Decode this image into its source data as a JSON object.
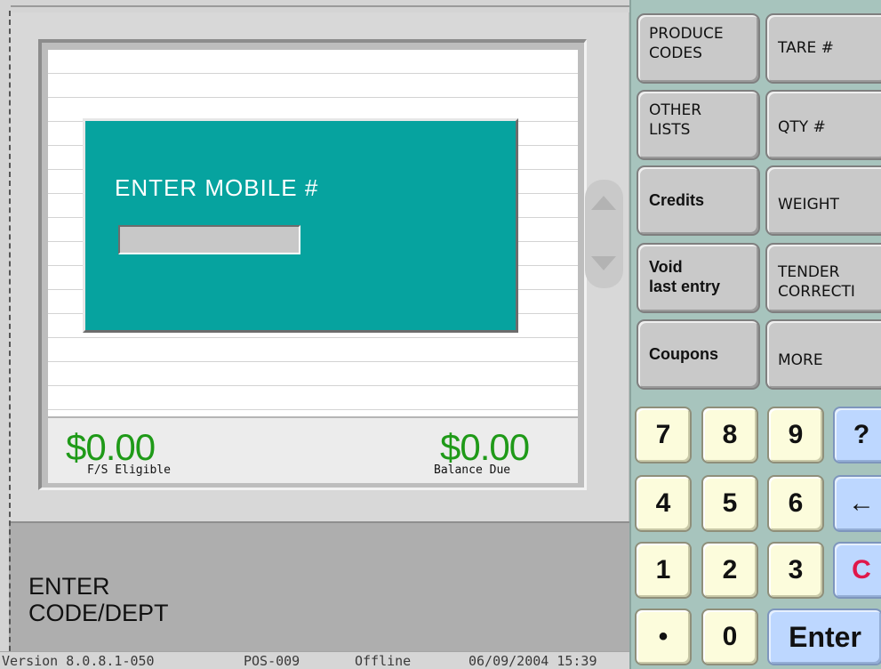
{
  "dialog": {
    "title": "ENTER MOBILE #",
    "input_value": ""
  },
  "totals": {
    "fs_eligible_amount": "$0.00",
    "fs_eligible_label": "F/S Eligible",
    "balance_due_amount": "$0.00",
    "balance_due_label": "Balance Due"
  },
  "prompt": {
    "line1": "ENTER",
    "line2": "CODE/DEPT"
  },
  "status": {
    "version": "Version  8.0.8.1-050",
    "pos": "POS-009",
    "connection": "Offline",
    "datetime": "06/09/2004 15:39"
  },
  "function_buttons": {
    "produce_codes": "PRODUCE\nCODES",
    "tare": "TARE #",
    "other_lists": "OTHER\nLISTS",
    "qty": "QTY #",
    "credits": "Credits",
    "weight": "WEIGHT",
    "void_last_entry": "Void\nlast entry",
    "tender_correction": "TENDER\nCORRECTI",
    "coupons": "Coupons",
    "more": "MORE"
  },
  "keypad": {
    "k7": "7",
    "k8": "8",
    "k9": "9",
    "help": "?",
    "k4": "4",
    "k5": "5",
    "k6": "6",
    "backspace": "←",
    "k1": "1",
    "k2": "2",
    "k3": "3",
    "clear": "C",
    "decimal": "•",
    "k0": "0",
    "enter": "Enter"
  },
  "colors": {
    "dialog_teal": "#06a39f",
    "money_green": "#1f9a18",
    "keypad_panel": "#a7c4bd",
    "key_cream": "#fcfcdc",
    "key_blue": "#bdd7ff",
    "clear_red": "#e0174a"
  },
  "icons": {
    "scroll_up": "triangle-up-icon",
    "scroll_down": "triangle-down-icon",
    "backspace": "left-arrow-icon"
  }
}
